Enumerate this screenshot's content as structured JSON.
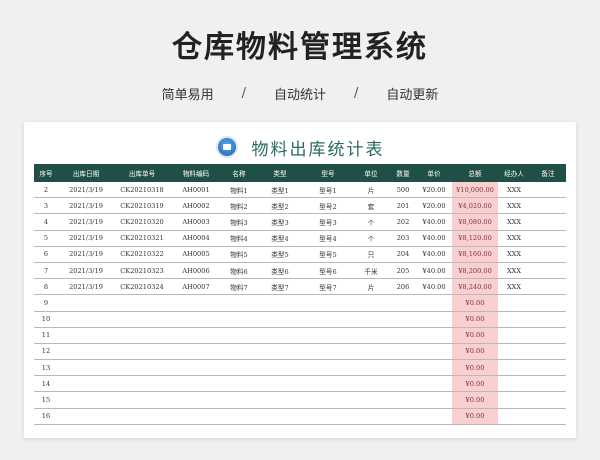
{
  "page": {
    "title": "仓库物料管理系统",
    "features": [
      "简单易用",
      "自动统计",
      "自动更新"
    ],
    "separator": "/"
  },
  "sheet": {
    "title": "物料出库统计表",
    "columns": [
      "序号",
      "出库日期",
      "出库单号",
      "物料编码",
      "名称",
      "类型",
      "型号",
      "单位",
      "数量",
      "单价",
      "总额",
      "经办人",
      "备注"
    ],
    "rows": [
      [
        "2",
        "2021/3/19",
        "CK20210318",
        "AH0001",
        "物料1",
        "类型1",
        "型号1",
        "片",
        "500",
        "¥20.00",
        "¥10,000.00",
        "XXX",
        ""
      ],
      [
        "3",
        "2021/3/19",
        "CK20210319",
        "AH0002",
        "物料2",
        "类型2",
        "型号2",
        "套",
        "201",
        "¥20.00",
        "¥4,020.00",
        "XXX",
        ""
      ],
      [
        "4",
        "2021/3/19",
        "CK20210320",
        "AH0003",
        "物料3",
        "类型3",
        "型号3",
        "个",
        "202",
        "¥40.00",
        "¥8,080.00",
        "XXX",
        ""
      ],
      [
        "5",
        "2021/3/19",
        "CK20210321",
        "AH0004",
        "物料4",
        "类型4",
        "型号4",
        "个",
        "203",
        "¥40.00",
        "¥8,120.00",
        "XXX",
        ""
      ],
      [
        "6",
        "2021/3/19",
        "CK20210322",
        "AH0005",
        "物料5",
        "类型5",
        "型号5",
        "只",
        "204",
        "¥40.00",
        "¥8,160.00",
        "XXX",
        ""
      ],
      [
        "7",
        "2021/3/19",
        "CK20210323",
        "AH0006",
        "物料6",
        "类型6",
        "型号6",
        "千米",
        "205",
        "¥40.00",
        "¥8,200.00",
        "XXX",
        ""
      ],
      [
        "8",
        "2021/3/19",
        "CK20210324",
        "AH0007",
        "物料7",
        "类型7",
        "型号7",
        "片",
        "206",
        "¥40.00",
        "¥8,240.00",
        "XXX",
        ""
      ],
      [
        "9",
        "",
        "",
        "",
        "",
        "",
        "",
        "",
        "",
        "",
        "¥0.00",
        "",
        ""
      ],
      [
        "10",
        "",
        "",
        "",
        "",
        "",
        "",
        "",
        "",
        "",
        "¥0.00",
        "",
        ""
      ],
      [
        "11",
        "",
        "",
        "",
        "",
        "",
        "",
        "",
        "",
        "",
        "¥0.00",
        "",
        ""
      ],
      [
        "12",
        "",
        "",
        "",
        "",
        "",
        "",
        "",
        "",
        "",
        "¥0.00",
        "",
        ""
      ],
      [
        "13",
        "",
        "",
        "",
        "",
        "",
        "",
        "",
        "",
        "",
        "¥0.00",
        "",
        ""
      ],
      [
        "14",
        "",
        "",
        "",
        "",
        "",
        "",
        "",
        "",
        "",
        "¥0.00",
        "",
        ""
      ],
      [
        "15",
        "",
        "",
        "",
        "",
        "",
        "",
        "",
        "",
        "",
        "¥0.00",
        "",
        ""
      ],
      [
        "16",
        "",
        "",
        "",
        "",
        "",
        "",
        "",
        "",
        "",
        "¥0.00",
        "",
        ""
      ]
    ]
  },
  "colors": {
    "header_bg": "#1f4f47",
    "total_highlight": "#f9cfcf",
    "title_color": "#2a6a5e"
  },
  "icons": {
    "logo": "box-logo-icon"
  }
}
